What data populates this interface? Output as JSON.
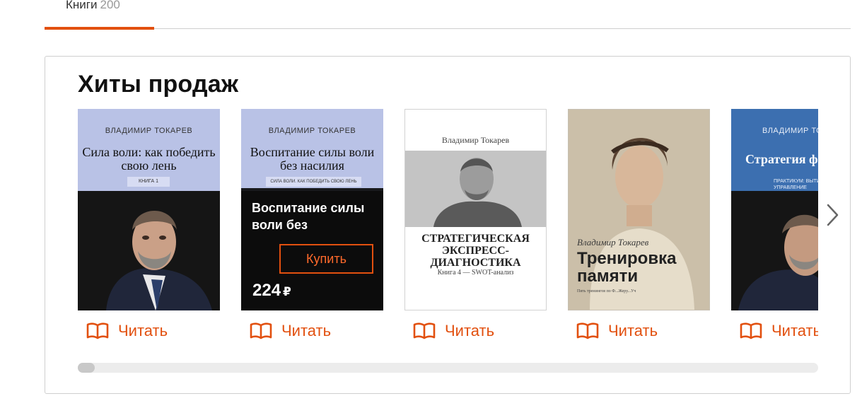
{
  "tabs": [
    {
      "label": "Книги",
      "count": "200",
      "active": true
    }
  ],
  "section": {
    "title": "Хиты продаж"
  },
  "books": [
    {
      "cover_author": "ВЛАДИМИР ТОКАРЕВ",
      "cover_title": "Сила воли: как победить свою лень",
      "cover_badge": "КНИГА 1",
      "read_label": "Читать"
    },
    {
      "cover_author": "ВЛАДИМИР ТОКАРЕВ",
      "cover_title": "Воспитание силы воли без насилия",
      "cover_badge": "СИЛА ВОЛИ. КАК ПОБЕДИТЬ СВОЮ ЛЕНЬ",
      "hover_title": "Воспитание силы воли без",
      "buy_label": "Купить",
      "price": "224",
      "currency": "₽",
      "read_label": "Читать"
    },
    {
      "cover_author": "Владимир Токарев",
      "cover_title": "СТРАТЕГИЧЕСКАЯ ЭКСПРЕСС-ДИАГНОСТИКА",
      "cover_subtitle": "Книга 4 — SWOT-анализ",
      "read_label": "Читать"
    },
    {
      "cover_author": "Владимир Токарев",
      "cover_title": "Тренировка памяти",
      "cover_subtitle": "Пять тренингов по Ф...Жеру...Уч",
      "read_label": "Читать"
    },
    {
      "cover_author": "ВЛАДИМИР ТОК",
      "cover_title": "Стратегия ф",
      "cover_subtitle": "ПРАКТИКУМ: ВЫТИ УПРАВЛЕНИЕ ИЗМЕН",
      "read_label": "Читать"
    }
  ],
  "carousel": {
    "next_icon": "chevron-right-icon",
    "scroll_position": 0.0
  },
  "colors": {
    "accent": "#e2500f",
    "border": "#cfcfcf"
  }
}
